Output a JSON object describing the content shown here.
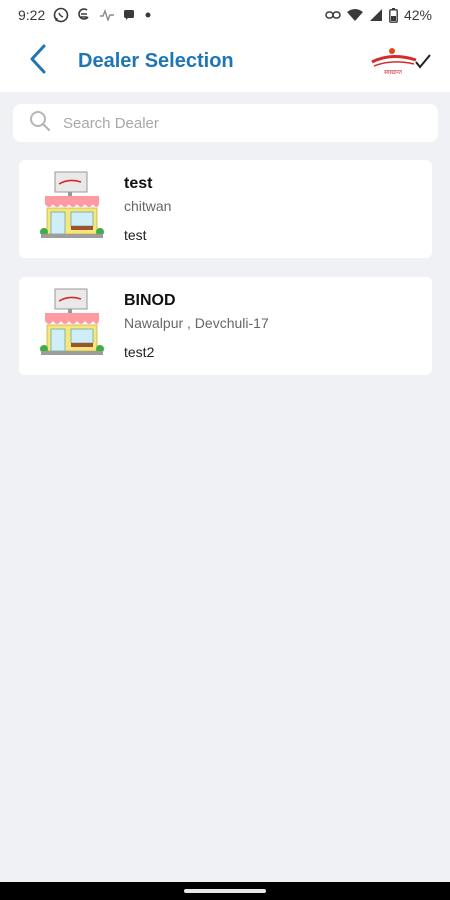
{
  "status_bar": {
    "time": "9:22",
    "battery": "42%",
    "icons": [
      "whatsapp-icon",
      "sync-icon",
      "pulse-icon",
      "message-icon",
      "dot-icon",
      "link-icon",
      "wifi-icon",
      "signal-icon",
      "battery-icon"
    ]
  },
  "header": {
    "title": "Dealer Selection",
    "back_icon": "chevron-left-icon",
    "brand_logo": "brand-logo",
    "logo_text": "स्वाद्यान्त"
  },
  "search": {
    "placeholder": "Search Dealer",
    "value": ""
  },
  "dealers": [
    {
      "name": "test",
      "address": "chitwan",
      "code": "test"
    },
    {
      "name": "BINOD",
      "address": "Nawalpur , Devchuli-17",
      "code": "test2"
    }
  ],
  "colors": {
    "accent": "#1f76b5",
    "background": "#eff1f5",
    "card": "#ffffff",
    "brand_red": "#d62b2b"
  }
}
